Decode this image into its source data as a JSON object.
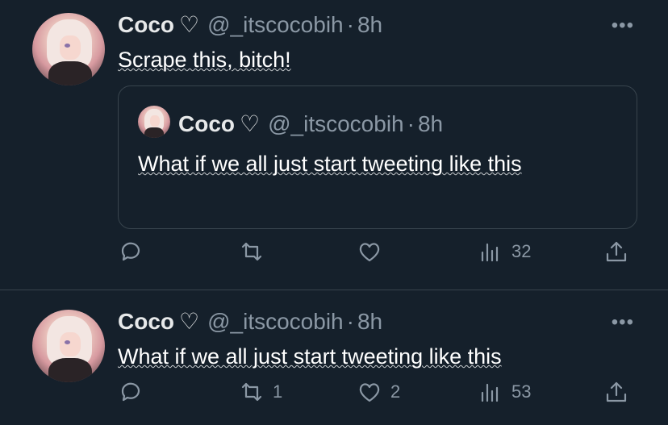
{
  "tweets": [
    {
      "author": {
        "name": "Coco",
        "emoji": "♡",
        "handle": "@_itscocobih",
        "separator": "·",
        "time": "8h"
      },
      "more_label": "•••",
      "text": "Scrape this, bitch!",
      "quote": {
        "author": {
          "name": "Coco",
          "emoji": "♡",
          "handle": "@_itscocobih",
          "separator": "·",
          "time": "8h"
        },
        "text": "What if we all just start tweeting like this"
      },
      "actions": {
        "reply": "",
        "retweet": "",
        "like": "",
        "views": "32"
      }
    },
    {
      "author": {
        "name": "Coco",
        "emoji": "♡",
        "handle": "@_itscocobih",
        "separator": "·",
        "time": "8h"
      },
      "more_label": "•••",
      "text": "What if we all just start tweeting like this",
      "actions": {
        "reply": "",
        "retweet": "1",
        "like": "2",
        "views": "53"
      }
    }
  ],
  "colors": {
    "background": "#15202b",
    "text": "#e7e9ea",
    "muted": "#8b98a5",
    "border": "#38444d"
  }
}
